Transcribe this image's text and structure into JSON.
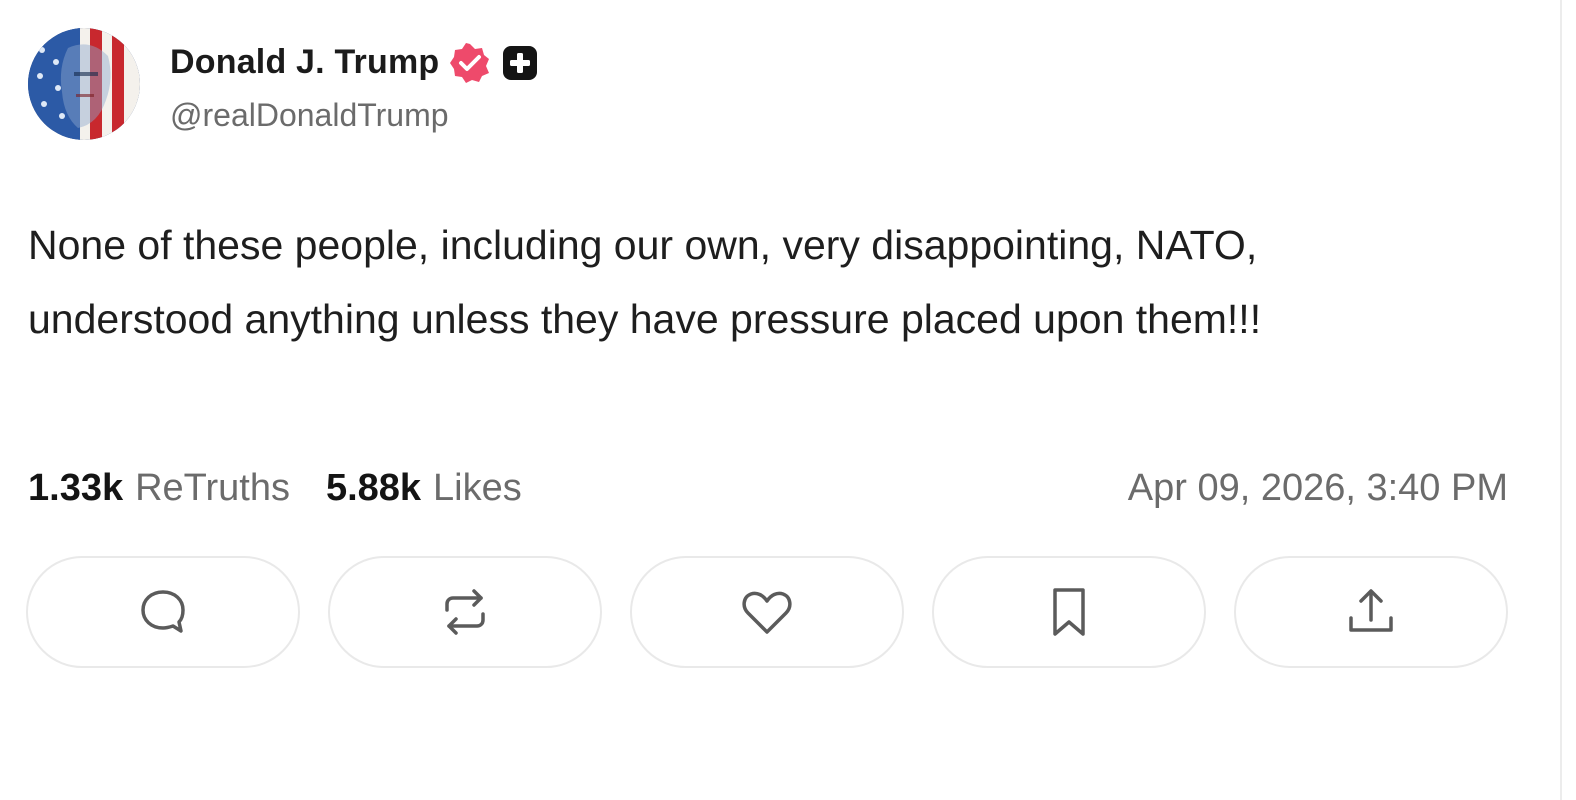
{
  "post": {
    "author": {
      "display_name": "Donald J. Trump",
      "handle": "@realDonaldTrump",
      "verified_badge_icon": "verified-check-icon",
      "plus_badge_icon": "plus-badge-icon"
    },
    "text": "None of these people, including our own, very disappointing, NATO, understood anything unless they have pressure placed upon them!!!",
    "stats": {
      "retruths_count": "1.33k",
      "retruths_label": "ReTruths",
      "likes_count": "5.88k",
      "likes_label": "Likes"
    },
    "timestamp": "Apr 09, 2026, 3:40 PM",
    "actions": [
      {
        "name": "reply",
        "icon": "comment-bubble-icon"
      },
      {
        "name": "retruth",
        "icon": "repost-arrows-icon"
      },
      {
        "name": "like",
        "icon": "heart-icon"
      },
      {
        "name": "bookmark",
        "icon": "bookmark-icon"
      },
      {
        "name": "share",
        "icon": "share-upload-icon"
      }
    ]
  },
  "colors": {
    "verified": "#ee4a6b",
    "text": "#1e1e1e",
    "muted": "#6b6b6b",
    "border": "#e9e9e9"
  }
}
